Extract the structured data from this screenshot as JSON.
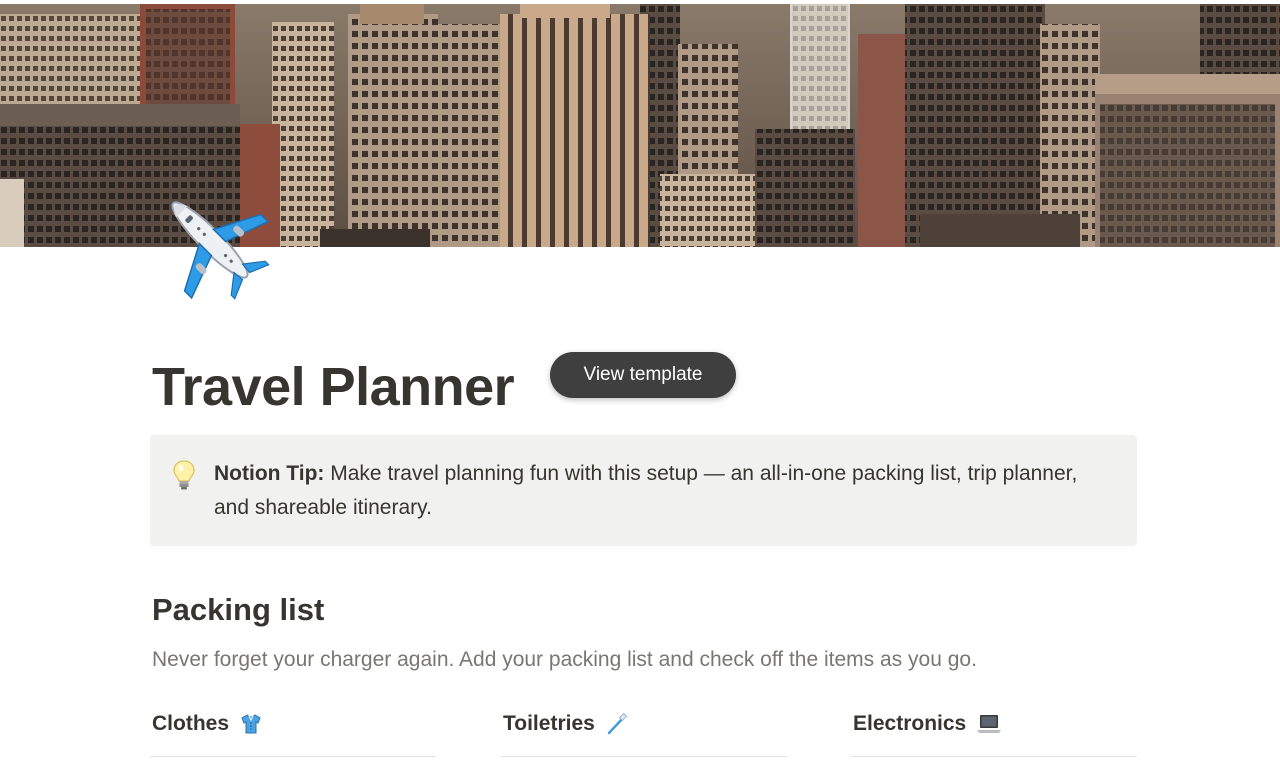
{
  "page": {
    "title": "Travel Planner",
    "icon": "airplane-icon",
    "cover": "city-skyline-cover"
  },
  "actions": {
    "view_template_label": "View template"
  },
  "callout": {
    "icon": "lightbulb-icon",
    "label": "Notion Tip:",
    "text": " Make travel planning fun with this setup — an all-in-one packing list, trip planner, and shareable itinerary."
  },
  "packing": {
    "heading": "Packing list",
    "subtitle": "Never forget your charger again. Add your packing list and check off the items as you go.",
    "columns": [
      {
        "label": "Clothes",
        "icon": "shirt-icon"
      },
      {
        "label": "Toiletries",
        "icon": "toothbrush-icon"
      },
      {
        "label": "Electronics",
        "icon": "laptop-icon"
      }
    ]
  },
  "colors": {
    "text": "#37352f",
    "muted": "#787774",
    "callout_bg": "#f1f1ef",
    "button_bg": "#3f3f3f"
  }
}
